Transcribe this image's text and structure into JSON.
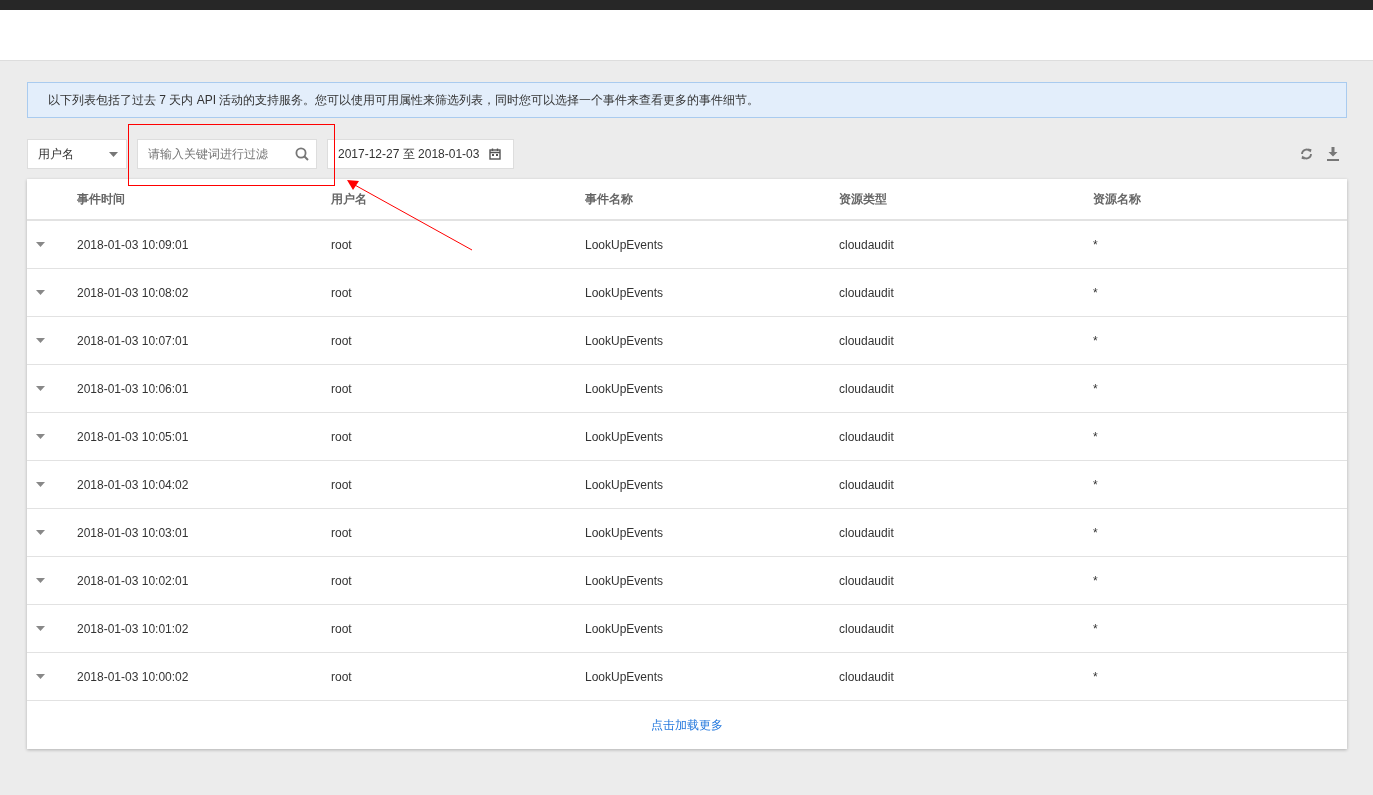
{
  "notice": "以下列表包括了过去 7 天内 API 活动的支持服务。您可以使用可用属性来筛选列表，同时您可以选择一个事件来查看更多的事件细节。",
  "filter": {
    "attribute": "用户名",
    "placeholder": "请输入关键词进行过滤",
    "date_range": "2017-12-27 至 2018-01-03"
  },
  "table": {
    "columns": [
      "事件时间",
      "用户名",
      "事件名称",
      "资源类型",
      "资源名称"
    ],
    "rows": [
      [
        "2018-01-03 10:09:01",
        "root",
        "LookUpEvents",
        "cloudaudit",
        "*"
      ],
      [
        "2018-01-03 10:08:02",
        "root",
        "LookUpEvents",
        "cloudaudit",
        "*"
      ],
      [
        "2018-01-03 10:07:01",
        "root",
        "LookUpEvents",
        "cloudaudit",
        "*"
      ],
      [
        "2018-01-03 10:06:01",
        "root",
        "LookUpEvents",
        "cloudaudit",
        "*"
      ],
      [
        "2018-01-03 10:05:01",
        "root",
        "LookUpEvents",
        "cloudaudit",
        "*"
      ],
      [
        "2018-01-03 10:04:02",
        "root",
        "LookUpEvents",
        "cloudaudit",
        "*"
      ],
      [
        "2018-01-03 10:03:01",
        "root",
        "LookUpEvents",
        "cloudaudit",
        "*"
      ],
      [
        "2018-01-03 10:02:01",
        "root",
        "LookUpEvents",
        "cloudaudit",
        "*"
      ],
      [
        "2018-01-03 10:01:02",
        "root",
        "LookUpEvents",
        "cloudaudit",
        "*"
      ],
      [
        "2018-01-03 10:00:02",
        "root",
        "LookUpEvents",
        "cloudaudit",
        "*"
      ]
    ],
    "load_more": "点击加载更多"
  }
}
